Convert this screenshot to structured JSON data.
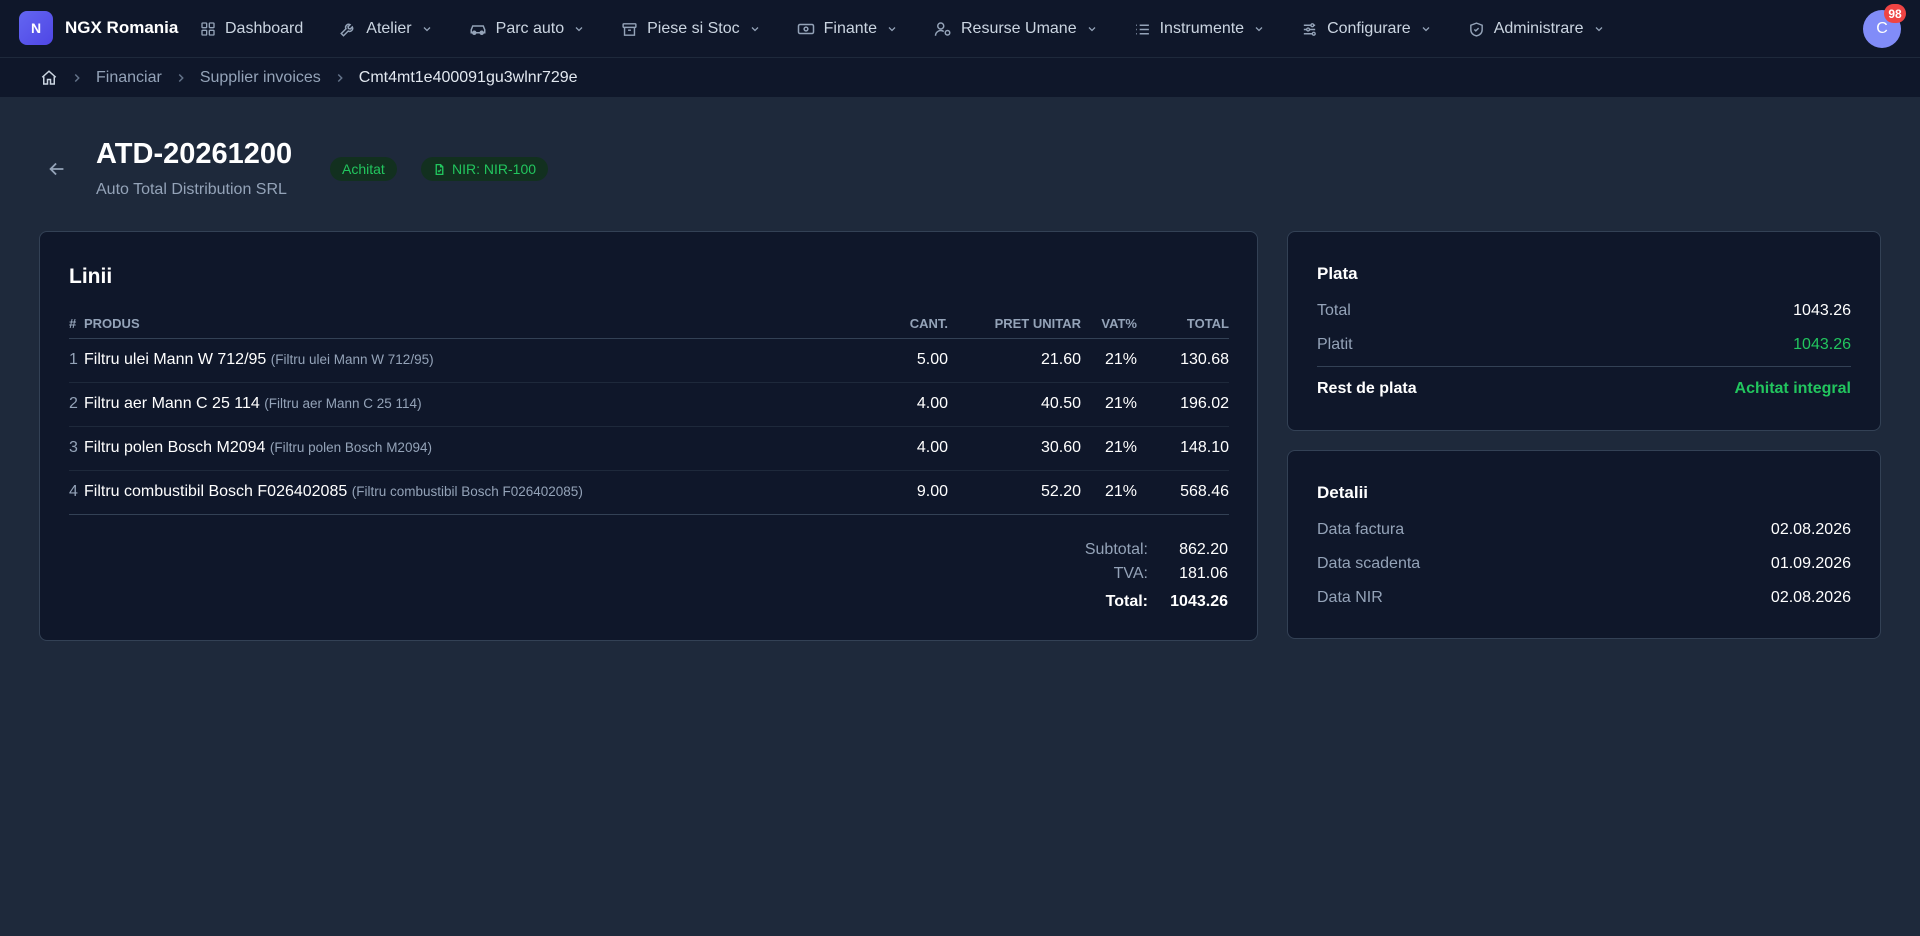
{
  "app": {
    "logo_letter": "N",
    "brand": "NGX Romania"
  },
  "nav": [
    {
      "label": "Dashboard",
      "icon": "grid-icon",
      "has_chevron": false
    },
    {
      "label": "Atelier",
      "icon": "wrench-icon",
      "has_chevron": true
    },
    {
      "label": "Parc auto",
      "icon": "car-icon",
      "has_chevron": true
    },
    {
      "label": "Piese si Stoc",
      "icon": "archive-icon",
      "has_chevron": true
    },
    {
      "label": "Finante",
      "icon": "banknote-icon",
      "has_chevron": true
    },
    {
      "label": "Resurse Umane",
      "icon": "user-gear-icon",
      "has_chevron": true
    },
    {
      "label": "Instrumente",
      "icon": "list-icon",
      "has_chevron": true
    },
    {
      "label": "Configurare",
      "icon": "sliders-icon",
      "has_chevron": true
    },
    {
      "label": "Administrare",
      "icon": "shield-icon",
      "has_chevron": true
    }
  ],
  "user": {
    "initial": "C",
    "notifications": "98"
  },
  "breadcrumb": {
    "items": [
      "Financiar",
      "Supplier invoices"
    ],
    "current": "Cmt4mt1e400091gu3wlnr729e"
  },
  "invoice": {
    "number": "ATD-20261200",
    "supplier": "Auto Total Distribution SRL",
    "status": "Achitat",
    "nir": "NIR: NIR-100"
  },
  "lines": {
    "title": "Linii",
    "columns": {
      "idx": "#",
      "product": "PRODUS",
      "qty": "CANT.",
      "unit_price": "PRET UNITAR",
      "vat": "VAT%",
      "total": "TOTAL"
    },
    "rows": [
      {
        "idx": "1",
        "name": "Filtru ulei Mann W 712/95",
        "ref": "(Filtru ulei Mann W 712/95)",
        "qty": "5.00",
        "price": "21.60",
        "vat": "21%",
        "total": "130.68"
      },
      {
        "idx": "2",
        "name": "Filtru aer Mann C 25 114",
        "ref": "(Filtru aer Mann C 25 114)",
        "qty": "4.00",
        "price": "40.50",
        "vat": "21%",
        "total": "196.02"
      },
      {
        "idx": "3",
        "name": "Filtru polen Bosch M2094",
        "ref": "(Filtru polen Bosch M2094)",
        "qty": "4.00",
        "price": "30.60",
        "vat": "21%",
        "total": "148.10"
      },
      {
        "idx": "4",
        "name": "Filtru combustibil Bosch F026402085",
        "ref": "(Filtru combustibil Bosch F026402085)",
        "qty": "9.00",
        "price": "52.20",
        "vat": "21%",
        "total": "568.46"
      }
    ],
    "subtotal_label": "Subtotal:",
    "subtotal": "862.20",
    "vat_label": "TVA:",
    "vat_total": "181.06",
    "total_label": "Total:",
    "total": "1043.26"
  },
  "payment": {
    "title": "Plata",
    "total_label": "Total",
    "total": "1043.26",
    "paid_label": "Platit",
    "paid": "1043.26",
    "remaining_label": "Rest de plata",
    "remaining": "Achitat integral"
  },
  "details": {
    "title": "Detalii",
    "invoice_date_label": "Data factura",
    "invoice_date": "02.08.2026",
    "due_date_label": "Data scadenta",
    "due_date": "01.09.2026",
    "nir_date_label": "Data NIR",
    "nir_date": "02.08.2026"
  },
  "colors": {
    "accent": "#6366f1",
    "success": "#22c55e",
    "danger": "#ef4444",
    "bg": "#1e293b",
    "card": "#0f172a"
  }
}
